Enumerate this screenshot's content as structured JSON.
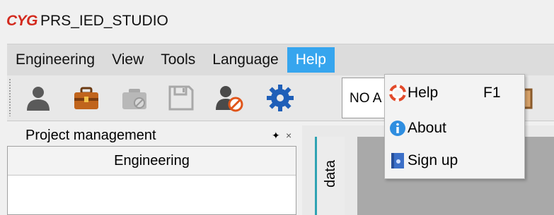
{
  "app": {
    "logo_text": "CYG",
    "title": "PRS_IED_STUDIO"
  },
  "menubar": {
    "items": [
      {
        "label": "Engineering"
      },
      {
        "label": "View"
      },
      {
        "label": "Tools"
      },
      {
        "label": "Language"
      },
      {
        "label": "Help",
        "active": true
      }
    ]
  },
  "toolbar": {
    "icons": [
      "user-icon",
      "briefcase-icon",
      "camera-disabled-icon",
      "save-icon",
      "user-blocked-icon",
      "gear-icon"
    ],
    "combo_value": "NO A"
  },
  "help_menu": {
    "items": [
      {
        "label": "Help",
        "shortcut": "F1",
        "icon": "lifebuoy-icon"
      },
      {
        "label": "About",
        "icon": "info-icon"
      },
      {
        "label": "Sign up",
        "icon": "signup-book-icon"
      }
    ]
  },
  "project_panel": {
    "title": "Project management",
    "pin_glyph": "✦",
    "close_glyph": "×",
    "column_header": "Engineering"
  },
  "side_tab": {
    "label": "data"
  },
  "colors": {
    "accent": "#36a5ee",
    "logo": "#d32a1e",
    "tab_indicator": "#2fa3b3"
  }
}
